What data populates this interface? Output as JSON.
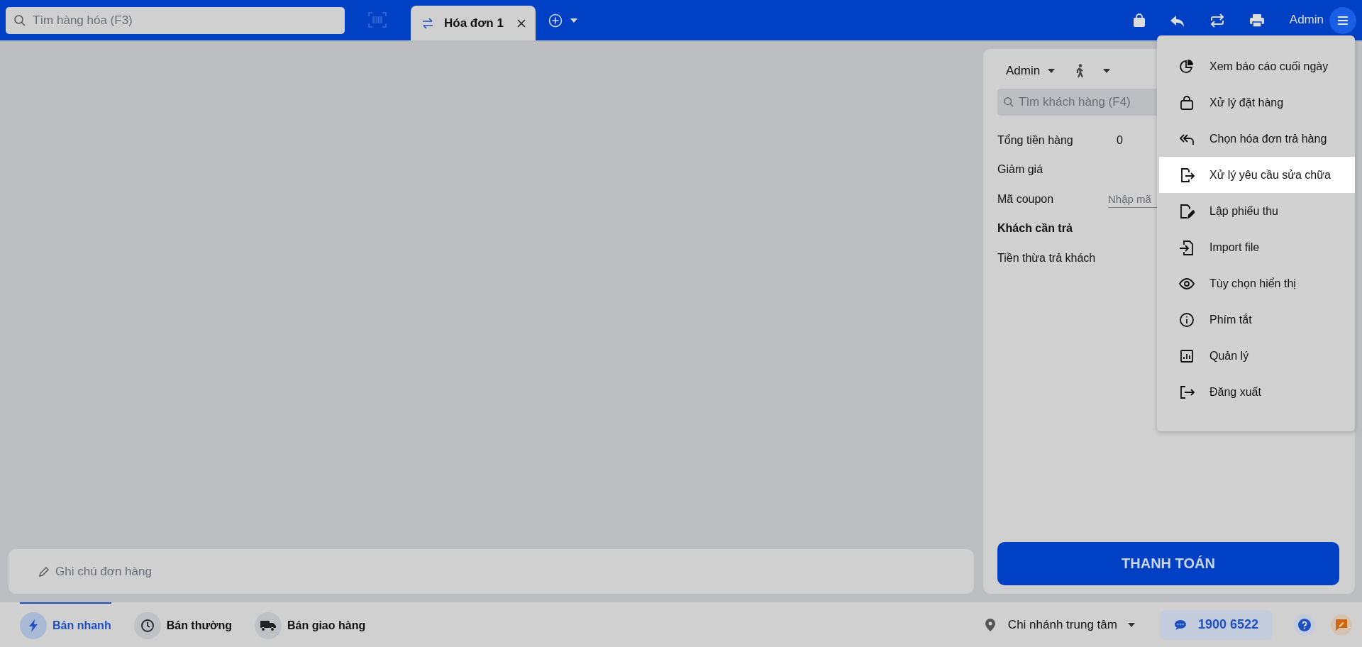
{
  "search": {
    "placeholder": "Tìm hàng hóa (F3)"
  },
  "tabs": [
    {
      "label": "Hóa đơn 1",
      "selected": true
    }
  ],
  "user": "Admin",
  "menu": [
    {
      "label": "Xem báo cáo cuối ngày",
      "kind": "report",
      "selected": false
    },
    {
      "label": "Xử lý đặt hàng",
      "kind": "bag",
      "selected": false
    },
    {
      "label": "Chọn hóa đơn trả hàng",
      "kind": "reply",
      "selected": false
    },
    {
      "label": "Xử lý yêu cầu sửa chữa",
      "kind": "export",
      "selected": true
    },
    {
      "label": "Lập phiếu thu",
      "kind": "edit",
      "selected": false
    },
    {
      "label": "Import file",
      "kind": "import",
      "selected": false
    },
    {
      "label": "Tùy chọn hiển thị",
      "kind": "eye",
      "selected": false
    },
    {
      "label": "Phím tắt",
      "kind": "info",
      "selected": false
    },
    {
      "label": "Quản lý",
      "kind": "chart",
      "selected": false
    },
    {
      "label": "Đăng xuất",
      "kind": "logout",
      "selected": false
    }
  ],
  "panel": {
    "seller": "Admin",
    "customer_search": {
      "placeholder": "Tìm khách hàng (F4)"
    },
    "rows": [
      {
        "label": "Tổng tiền hàng",
        "value": "0",
        "kind": "text"
      },
      {
        "label": "Giảm giá",
        "kind": "text"
      },
      {
        "label": "Mã coupon",
        "kind": "input",
        "placeholder": "Nhập mã"
      },
      {
        "label": "Khách cần trả",
        "kind": "bold"
      },
      {
        "label": "Tiền thừa trả khách",
        "kind": "text"
      }
    ],
    "pay_button": "THANH TOÁN"
  },
  "note": {
    "placeholder": "Ghi chú đơn hàng"
  },
  "modes": [
    {
      "label": "Bán nhanh",
      "kind": "bolt",
      "selected": true
    },
    {
      "label": "Bán thường",
      "kind": "clock",
      "selected": false
    },
    {
      "label": "Bán giao hàng",
      "kind": "truck",
      "selected": false
    }
  ],
  "branch": "Chi nhánh trung tâm",
  "hotline": "1900 6522"
}
